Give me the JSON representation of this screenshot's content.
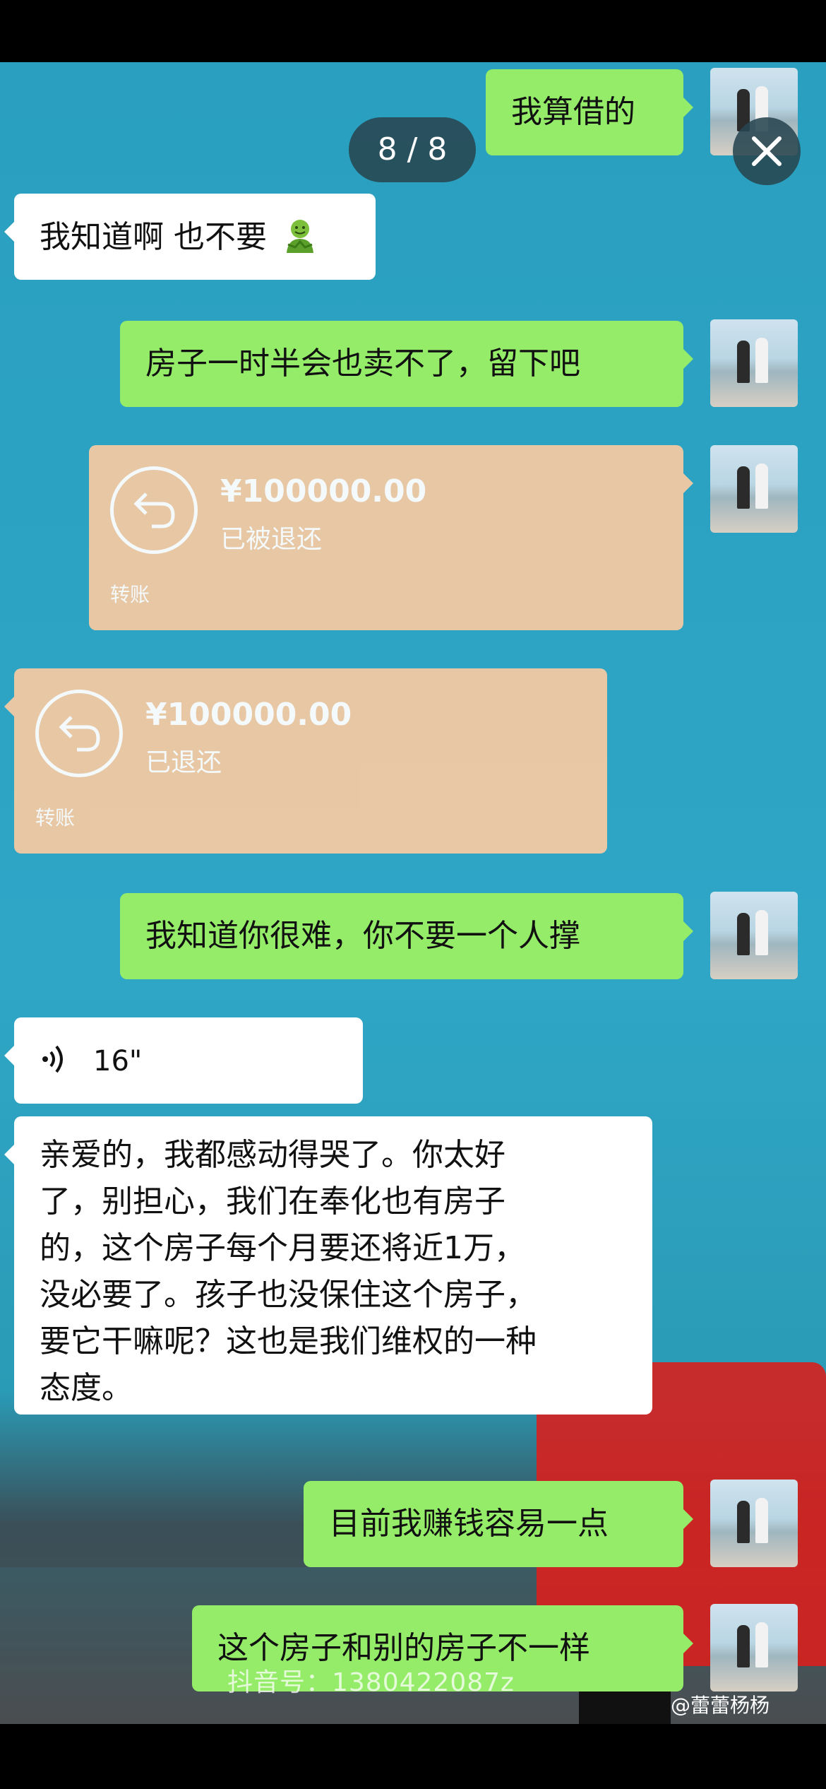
{
  "viewer": {
    "counter": "8 / 8"
  },
  "messages": [
    {
      "side": "right",
      "text": "我算借的"
    },
    {
      "side": "left",
      "text": "我知道啊 也不要"
    },
    {
      "side": "right",
      "text": "房子一时半会也卖不了，留下吧"
    },
    {
      "side": "right",
      "type": "transfer",
      "amount": "¥100000.00",
      "status": "已被退还",
      "label": "转账"
    },
    {
      "side": "left",
      "type": "transfer",
      "amount": "¥100000.00",
      "status": "已退还",
      "label": "转账"
    },
    {
      "side": "right",
      "text": "我知道你很难，你不要一个人撑"
    },
    {
      "side": "left",
      "type": "voice",
      "duration": "16\""
    },
    {
      "side": "left",
      "lines": [
        "亲爱的，我都感动得哭了。你太好",
        "了，别担心，我们在奉化也有房子",
        "的，这个房子每个月要还将近1万，",
        "没必要了。孩子也没保住这个房子，",
        "要它干嘛呢？这也是我们维权的一种",
        "态度。"
      ]
    },
    {
      "side": "right",
      "text": "目前我赚钱容易一点"
    },
    {
      "side": "right",
      "text": "这个房子和别的房子不一样"
    }
  ],
  "watermark": {
    "text": "抖音号：1380422087z",
    "weibo": "@蕾蕾杨杨"
  },
  "colors": {
    "green_bubble": "#95ec69",
    "white_bubble": "#ffffff",
    "transfer": "#f2c9a3",
    "background": "#2fa6c6"
  },
  "icons": {
    "close": "close-icon",
    "voice": "voice-wave-icon",
    "transfer": "return-arrow-icon",
    "emoji": "green-face-emoji"
  }
}
